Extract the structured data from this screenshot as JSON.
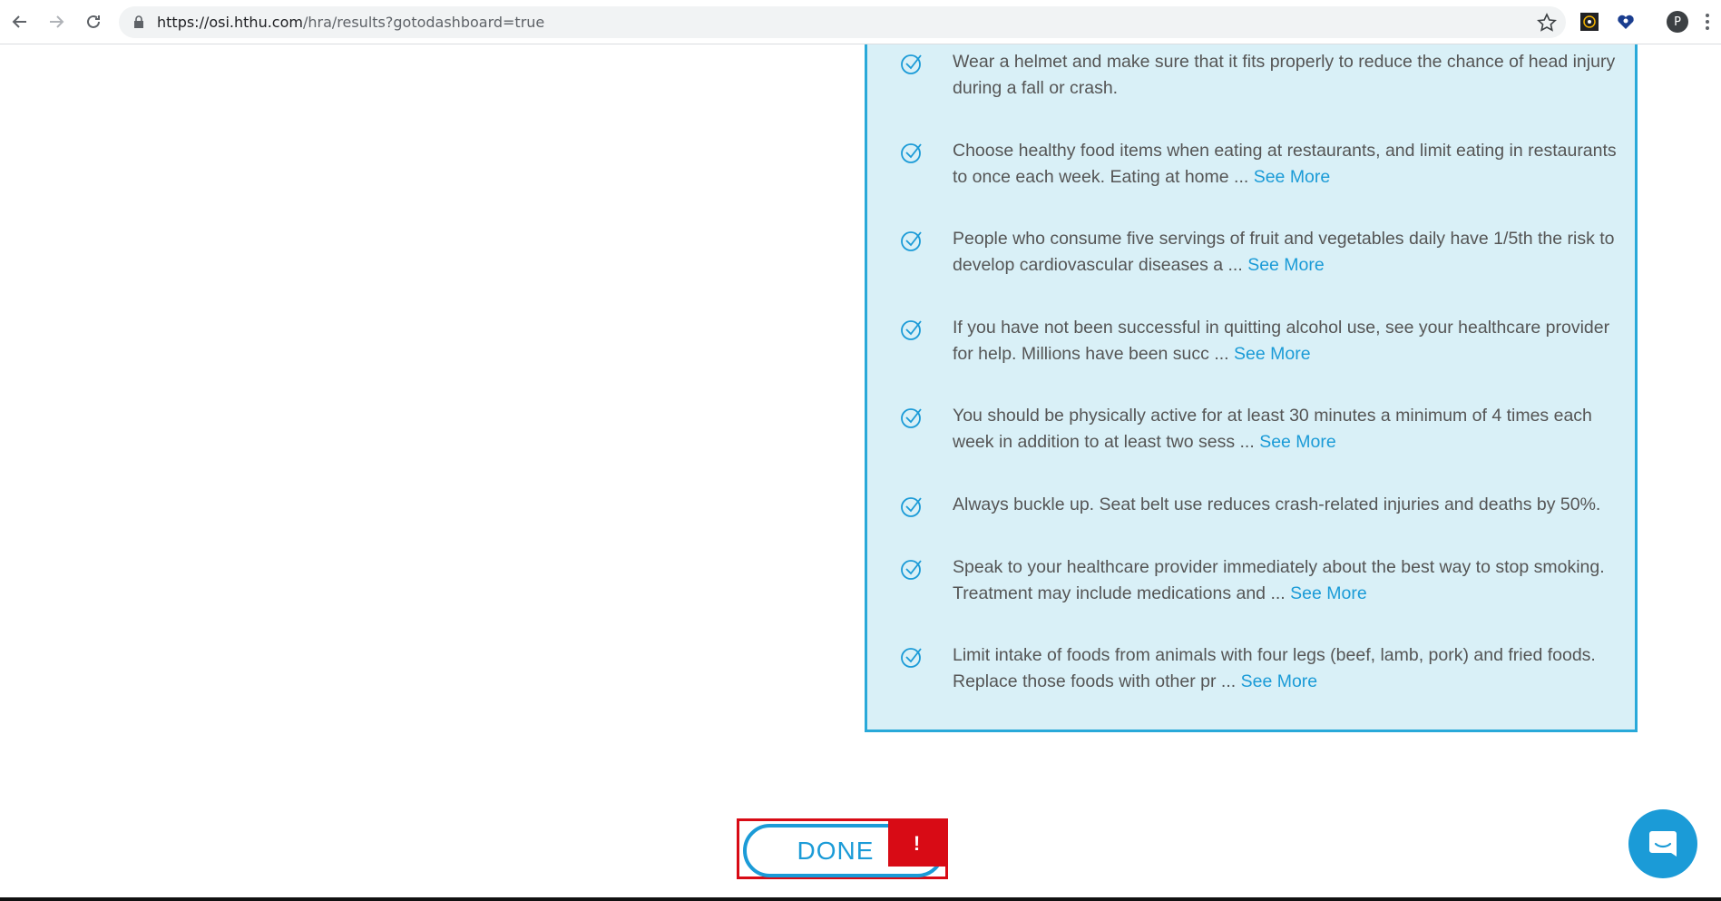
{
  "browser": {
    "url_host": "https://osi.hthu.com",
    "url_path": "/hra/results?gotodashboard=true",
    "avatar_letter": "P"
  },
  "tips": [
    {
      "text": "Wear a helmet and make sure that it fits properly to reduce the chance of head injury during a fall or crash.",
      "see_more": ""
    },
    {
      "text": "Choose healthy food items when eating at restaurants, and limit eating in restaurants to once each week. Eating at home ... ",
      "see_more": "See More"
    },
    {
      "text": "People who consume five servings of fruit and vegetables daily have 1/5th the risk to develop cardiovascular diseases a ... ",
      "see_more": "See More"
    },
    {
      "text": "If you have not been successful in quitting alcohol use, see your healthcare provider for help. Millions have been succ ... ",
      "see_more": "See More"
    },
    {
      "text": "You should be physically active for at least 30 minutes a minimum of 4 times each week in addition to at least two sess ... ",
      "see_more": "See More"
    },
    {
      "text": "Always buckle up. Seat belt use reduces crash-related injuries and deaths by 50%.",
      "see_more": ""
    },
    {
      "text": "Speak to your healthcare provider immediately about the best way to stop smoking. Treatment may include medications and ... ",
      "see_more": "See More"
    },
    {
      "text": "Limit intake of foods from animals with four legs (beef, lamb, pork) and fried foods. Replace those foods with other pr ... ",
      "see_more": "See More"
    }
  ],
  "done_button": {
    "label": "DONE",
    "error_mark": "!"
  },
  "icons": {
    "back": "arrow-left-icon",
    "forward": "arrow-right-icon",
    "reload": "reload-icon",
    "lock": "lock-icon",
    "star": "star-icon",
    "check": "check-circle-icon",
    "chat": "chat-icon"
  },
  "colors": {
    "accent": "#1b9bd7",
    "panel_bg": "#d9f0f7",
    "panel_border": "#29a9d9",
    "error": "#d80b15"
  }
}
